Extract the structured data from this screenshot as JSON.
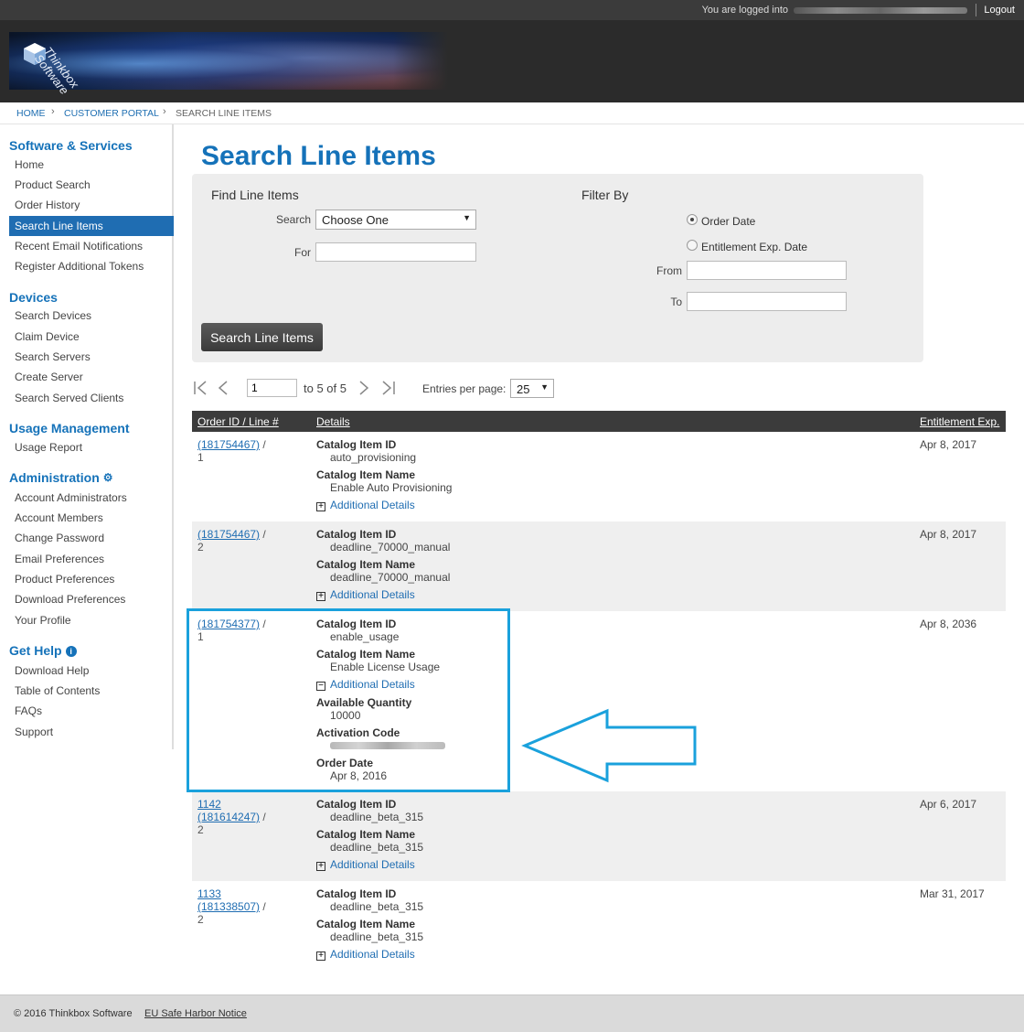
{
  "topbar": {
    "logged_in_text": "You are logged into",
    "logout_label": "Logout"
  },
  "brand": {
    "line1": "Thinkbox",
    "line2": "Software"
  },
  "breadcrumb": {
    "home": "HOME",
    "portal": "CUSTOMER PORTAL",
    "current": "SEARCH LINE ITEMS"
  },
  "sidebar": {
    "software_services": {
      "heading": "Software & Services",
      "items": [
        "Home",
        "Product Search",
        "Order History",
        "Search Line Items",
        "Recent Email Notifications",
        "Register Additional Tokens"
      ]
    },
    "devices": {
      "heading": "Devices",
      "items": [
        "Search Devices",
        "Claim Device",
        "Search Servers",
        "Create Server",
        "Search Served Clients"
      ]
    },
    "usage": {
      "heading": "Usage Management",
      "items": [
        "Usage Report"
      ]
    },
    "administration": {
      "heading": "Administration",
      "items": [
        "Account Administrators",
        "Account Members",
        "Change Password",
        "Email Preferences",
        "Product Preferences",
        "Download Preferences",
        "Your Profile"
      ]
    },
    "help": {
      "heading": "Get Help",
      "items": [
        "Download Help",
        "Table of Contents",
        "FAQs",
        "Support"
      ]
    }
  },
  "page": {
    "title": "Search Line Items"
  },
  "search_panel": {
    "find_heading": "Find Line Items",
    "search_label": "Search",
    "search_select_value": "Choose One",
    "for_label": "For",
    "for_value": "",
    "filter_heading": "Filter By",
    "radio_order_date": "Order Date",
    "radio_entitlement": "Entitlement Exp. Date",
    "from_label": "From",
    "to_label": "To",
    "from_value": "",
    "to_value": "",
    "button_label": "Search Line Items"
  },
  "pager": {
    "page_value": "1",
    "range_text": "to 5 of 5",
    "entries_label": "Entries per page:",
    "entries_value": "25"
  },
  "table": {
    "headers": {
      "order": "Order ID / Line #",
      "details": "Details",
      "exp": "Entitlement Exp."
    },
    "labels": {
      "catalog_id": "Catalog Item ID",
      "catalog_name": "Catalog Item Name",
      "additional": "Additional Details",
      "available_qty": "Available Quantity",
      "activation_code": "Activation Code",
      "order_date": "Order Date"
    },
    "rows": [
      {
        "order_prefix": "",
        "order_id": "(181754467)",
        "line": "1",
        "catalog_id": "auto_provisioning",
        "catalog_name": "Enable Auto Provisioning",
        "exp": "Apr 8, 2017"
      },
      {
        "order_prefix": "",
        "order_id": "(181754467)",
        "line": "2",
        "catalog_id": "deadline_70000_manual",
        "catalog_name": "deadline_70000_manual",
        "exp": "Apr 8, 2017"
      },
      {
        "order_prefix": "",
        "order_id": "(181754377)",
        "line": "1",
        "catalog_id": "enable_usage",
        "catalog_name": "Enable License Usage",
        "exp": "Apr 8, 2036",
        "available_qty": "10000",
        "order_date": "Apr 8, 2016"
      },
      {
        "order_prefix": "1142",
        "order_id": "(181614247)",
        "line": "2",
        "catalog_id": "deadline_beta_315",
        "catalog_name": "deadline_beta_315",
        "exp": "Apr 6, 2017"
      },
      {
        "order_prefix": "1133",
        "order_id": "(181338507)",
        "line": "2",
        "catalog_id": "deadline_beta_315",
        "catalog_name": "deadline_beta_315",
        "exp": "Mar 31, 2017"
      }
    ]
  },
  "footer": {
    "copyright": "© 2016 Thinkbox Software",
    "safe_harbor": "EU Safe Harbor Notice"
  },
  "colors": {
    "accent_blue": "#1572b9",
    "highlight_cyan": "#1aa1dc",
    "header_dark": "#2b2b2b"
  },
  "icons": {
    "first_page": "first-page-icon",
    "prev_page": "prev-page-icon",
    "next_page": "next-page-icon",
    "last_page": "last-page-icon",
    "gear": "gear-icon",
    "info": "info-icon",
    "expand": "plus-box-icon",
    "collapse": "minus-box-icon"
  }
}
